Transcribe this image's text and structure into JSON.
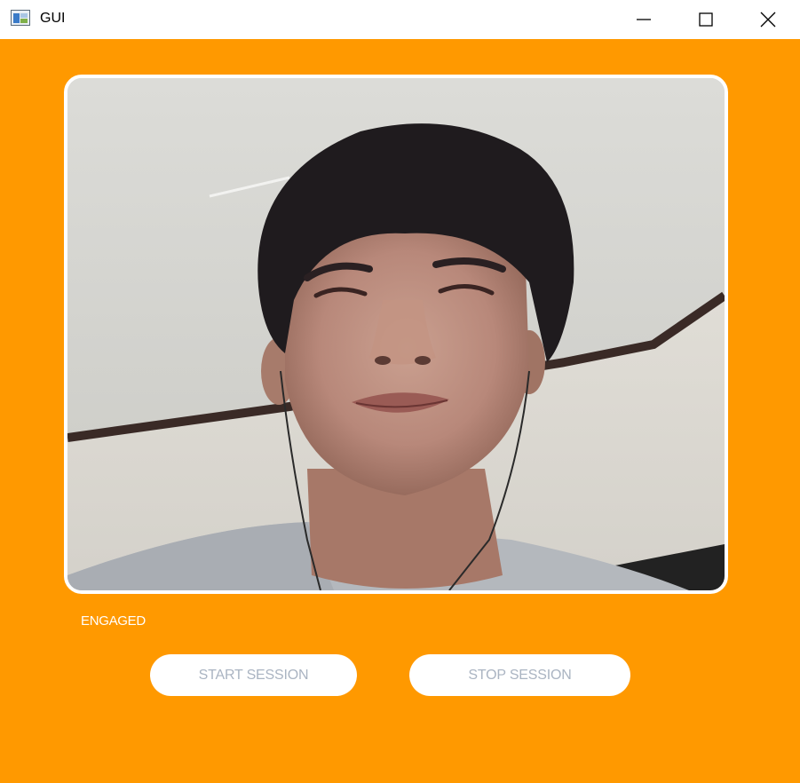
{
  "window": {
    "title": "GUI",
    "controls": [
      "minimize-icon",
      "maximize-icon",
      "close-icon"
    ]
  },
  "video": {
    "description_icon": "webcam-feed"
  },
  "status": {
    "label": "ENGAGED"
  },
  "buttons": {
    "start_label": "START SESSION",
    "stop_label": "STOP SESSION"
  },
  "colors": {
    "background": "#ff9900",
    "button_bg": "#ffffff",
    "button_text": "#aab4c2",
    "status_text": "#ffffff"
  }
}
